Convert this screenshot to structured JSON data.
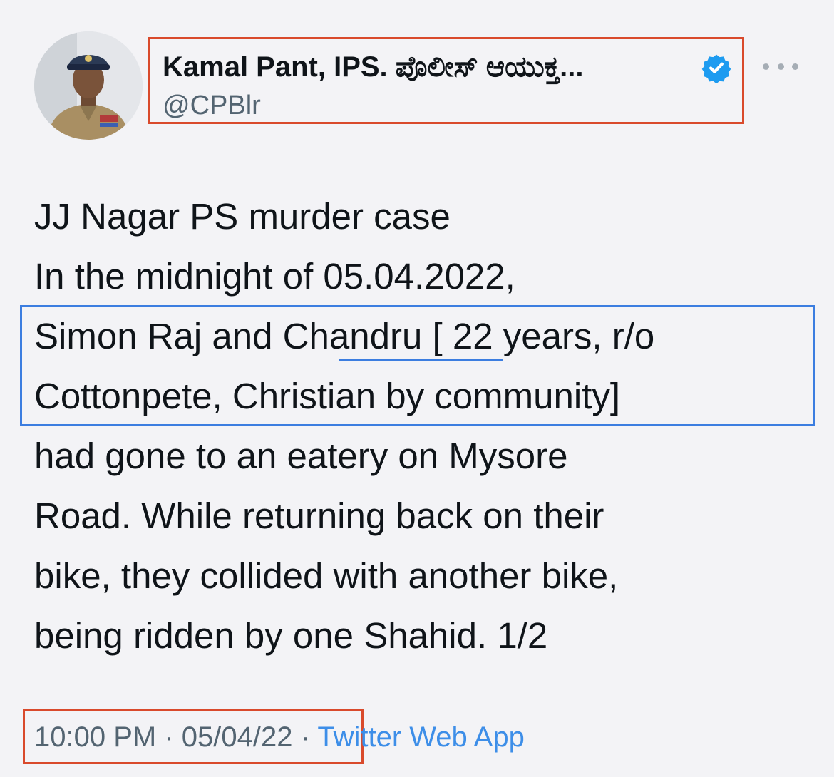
{
  "tweet": {
    "author": {
      "display_name": "Kamal Pant, IPS. ಪೊಲೀಸ್ ಆಯುಕ್ತ...",
      "handle": "@CPBlr",
      "verified": true,
      "verified_icon": "verified-badge-icon",
      "avatar": "police-officer-photo"
    },
    "more_icon": "more-options-icon",
    "text_lines": [
      "JJ Nagar PS murder case",
      "In the midnight of 05.04.2022,",
      "Simon Raj and Chandru [ 22 years, r/o",
      "Cottonpete, Christian by community]",
      "had gone to an eatery on Mysore",
      "Road. While returning back on their",
      "bike, they collided with another bike,",
      "being ridden by one Shahid. 1/2"
    ],
    "time": "10:00 PM",
    "date": "05/04/22",
    "separator": "·",
    "source": "Twitter Web App"
  },
  "colors": {
    "background": "#f3f3f6",
    "annotation_red": "#d94a2c",
    "annotation_blue": "#3b7de0",
    "link_blue": "#3d8ee8",
    "verified_blue": "#1d9bf0",
    "secondary_text": "#536471"
  }
}
